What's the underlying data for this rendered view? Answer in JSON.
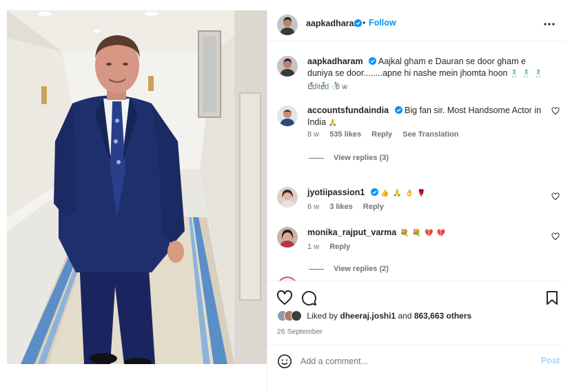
{
  "post": {
    "author": "aapkadharam",
    "follow_label": "Follow",
    "separator": "•",
    "caption": "Aajkal gham e Dauran se door gham e duniya se door........apne hi nashe mein jhomta hoon",
    "caption_emoji": "🕺 🕺 🕺 🕺 🕺 🕺 .",
    "caption_meta": "Edited · 8 w"
  },
  "comments": [
    {
      "username": "accountsfundaindia",
      "verified": true,
      "text": "Big fan sir. Most Handsome Actor in India",
      "emoji": "🙏",
      "time": "8 w",
      "likes": "535 likes",
      "reply_label": "Reply",
      "translation_label": "See Translation",
      "view_replies": "View replies (3)"
    },
    {
      "username": "jyotiipassion1",
      "verified": true,
      "text": "",
      "emoji": "👍 🙏 👌 🌹",
      "time": "6 w",
      "likes": "3 likes",
      "reply_label": "Reply"
    },
    {
      "username": "monika_rajput_varma",
      "verified": false,
      "text": "",
      "emoji": "💐 💐 💔 💔",
      "time": "1 w",
      "reply_label": "Reply",
      "view_replies": "View replies (2)"
    }
  ],
  "likes": {
    "prefix": "Liked by",
    "user": "dheeraj.joshi1",
    "joiner": "and",
    "others": "863,663 others"
  },
  "date": "26 September",
  "comment_box": {
    "placeholder": "Add a comment...",
    "post_label": "Post"
  },
  "colors": {
    "link_blue": "#0095f6",
    "post_disabled": "#9fd5fb",
    "verified_blue": "#0095f6",
    "suit_navy": "#1e2f6e",
    "secondary_text": "#737373"
  },
  "icons": [
    "verified-badge-icon",
    "more-options-icon",
    "heart-icon",
    "comment-icon",
    "bookmark-icon",
    "emoji-icon"
  ]
}
